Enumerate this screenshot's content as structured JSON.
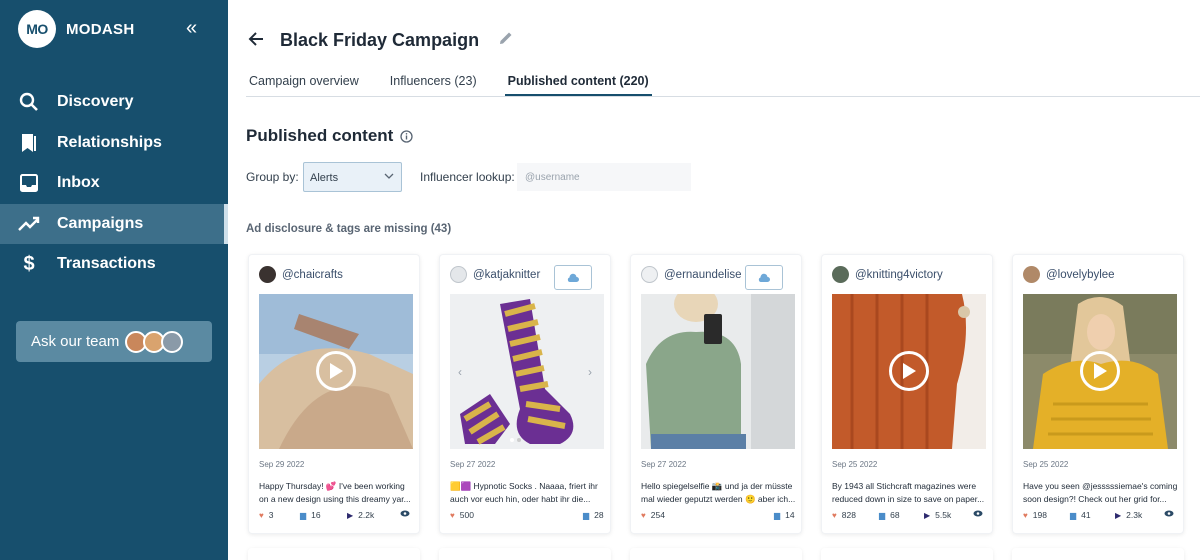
{
  "sidebar": {
    "logo_text": "MO",
    "brand": "MODASH",
    "collapse_icon": "double-chevron-left-icon",
    "items": [
      {
        "label": "Discovery",
        "icon": "search-icon"
      },
      {
        "label": "Relationships",
        "icon": "bookmarks-icon"
      },
      {
        "label": "Inbox",
        "icon": "inbox-icon"
      },
      {
        "label": "Campaigns",
        "icon": "trending-up-icon",
        "active": true
      },
      {
        "label": "Transactions",
        "icon": "dollar-icon"
      }
    ],
    "ask_team": "Ask our team"
  },
  "header": {
    "title": "Black Friday Campaign",
    "tabs": [
      {
        "label": "Campaign overview"
      },
      {
        "label": "Influencers (23)"
      },
      {
        "label": "Published content (220)",
        "active": true
      }
    ]
  },
  "content": {
    "section_title": "Published content",
    "group_by_label": "Group by:",
    "group_by_value": "Alerts",
    "lookup_label": "Influencer lookup:",
    "lookup_placeholder": "@username",
    "group_heading": "Ad disclosure & tags are missing (43)"
  },
  "cards": [
    {
      "user": "@chaicrafts",
      "date": "Sep 29 2022",
      "text": "Happy Thursday! 💕 I've been working on a new design using this dreamy yar...",
      "likes": "3",
      "comments": "16",
      "views": "2.2k",
      "has_download": false,
      "has_play": true,
      "has_views": true
    },
    {
      "user": "@katjaknitter",
      "date": "Sep 27 2022",
      "text": "🟨🟪 Hypnotic Socks . Naaaa, friert ihr auch vor euch hin, oder habt ihr die...",
      "likes": "500",
      "comments": "28",
      "views": "",
      "has_download": true,
      "has_play": false,
      "has_views": false
    },
    {
      "user": "@ernaundelise",
      "date": "Sep 27 2022",
      "text": "Hello spiegelselfie 📸 und ja der müsste mal wieder geputzt werden 🙂 aber ich...",
      "likes": "254",
      "comments": "14",
      "views": "",
      "has_download": true,
      "has_play": false,
      "has_views": false
    },
    {
      "user": "@knitting4victory",
      "date": "Sep 25 2022",
      "text": "By 1943 all Stichcraft magazines were reduced down in size to save on paper...",
      "likes": "828",
      "comments": "68",
      "views": "5.5k",
      "has_download": false,
      "has_play": true,
      "has_views": true
    },
    {
      "user": "@lovelybylee",
      "date": "Sep 25 2022",
      "text": "Have you seen @jesssssiemae's coming soon design?! Check out her grid for...",
      "likes": "198",
      "comments": "41",
      "views": "2.3k",
      "has_download": false,
      "has_play": true,
      "has_views": true
    }
  ]
}
